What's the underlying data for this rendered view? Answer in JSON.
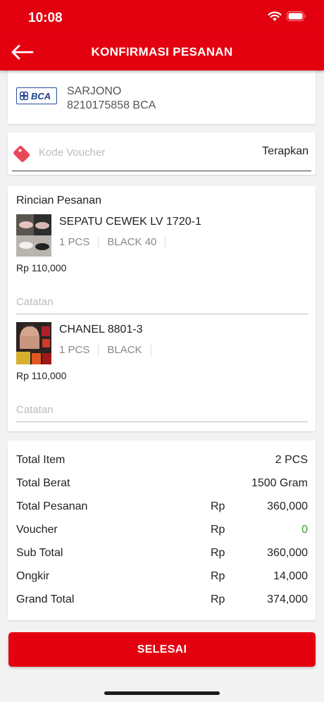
{
  "status_bar": {
    "time": "10:08"
  },
  "header": {
    "title": "KONFIRMASI PESANAN",
    "back_icon": "arrow-left-icon"
  },
  "bank": {
    "logo_text": "BCA",
    "name": "SARJONO",
    "account": "8210175858 BCA"
  },
  "voucher": {
    "placeholder": "Kode Voucher",
    "apply_label": "Terapkan",
    "icon": "tag-icon"
  },
  "order_details": {
    "title": "Rincian Pesanan",
    "items": [
      {
        "name": "SEPATU CEWEK LV 1720-1",
        "qty": "1 PCS",
        "variant": "BLACK 40",
        "price": "Rp 110,000",
        "note_placeholder": "Catatan"
      },
      {
        "name": "CHANEL 8801-3",
        "qty": "1 PCS",
        "variant": "BLACK",
        "price": "Rp 110,000",
        "note_placeholder": "Catatan"
      }
    ]
  },
  "summary": {
    "rows": [
      {
        "label": "Total Item",
        "currency": "",
        "value": "2 PCS"
      },
      {
        "label": "Total Berat",
        "currency": "",
        "value": "1500 Gram"
      },
      {
        "label": "Total Pesanan",
        "currency": "Rp",
        "value": "360,000"
      },
      {
        "label": "Voucher",
        "currency": "Rp",
        "value": "0"
      },
      {
        "label": "Sub Total",
        "currency": "Rp",
        "value": "360,000"
      },
      {
        "label": "Ongkir",
        "currency": "Rp",
        "value": "14,000"
      },
      {
        "label": "Grand Total",
        "currency": "Rp",
        "value": "374,000"
      }
    ]
  },
  "actions": {
    "finish_label": "SELESAI"
  },
  "colors": {
    "brand_red": "#e3000f",
    "voucher_value_green": "#3a9a2a"
  }
}
